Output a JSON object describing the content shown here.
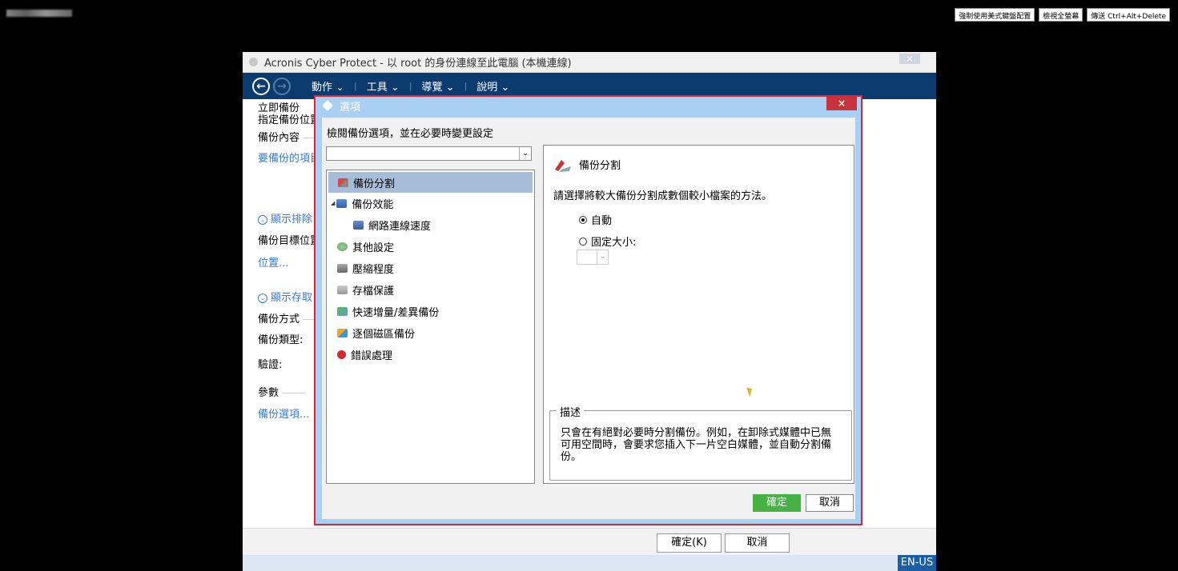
{
  "top_buttons": [
    "強制使用美式鍵盤配置",
    "檢視全螢幕",
    "傳送 Ctrl+Alt+Delete"
  ],
  "window": {
    "title": "Acronis Cyber Protect - 以 root 的身份連線至此電腦 (本機連線)",
    "close_label": "×",
    "menu": [
      "動作",
      "工具",
      "導覽",
      "說明"
    ]
  },
  "left_panel": {
    "items": [
      "立即備份",
      "指定備份位置",
      "備份內容",
      "要備份的項目",
      "顯示排除",
      "備份目標位置",
      "位置...",
      "顯示存取",
      "備份方式",
      "備份類型:",
      "驗證:",
      "參數",
      "備份選項..."
    ]
  },
  "bottom": {
    "ok": "確定(K)",
    "cancel": "取消",
    "lang": "EN-US"
  },
  "dialog": {
    "title": "選項",
    "close": "×",
    "hint": "檢閱備份選項，並在必要時變更設定",
    "tree": [
      {
        "label": "備份分割",
        "icon": "split-icon",
        "selected": true
      },
      {
        "label": "備份效能",
        "icon": "performance-icon"
      },
      {
        "label": "網路連線速度",
        "icon": "network-icon"
      },
      {
        "label": "其他設定",
        "icon": "settings-icon"
      },
      {
        "label": "壓縮程度",
        "icon": "compression-icon"
      },
      {
        "label": "存檔保護",
        "icon": "lock-icon"
      },
      {
        "label": "快速增量/差異備份",
        "icon": "incremental-icon"
      },
      {
        "label": "逐個磁區備份",
        "icon": "sector-icon"
      },
      {
        "label": "錯誤處理",
        "icon": "error-icon"
      }
    ],
    "right": {
      "heading": "備份分割",
      "description": "請選擇將較大備份分割成數個較小檔案的方法。",
      "option_auto": "自動",
      "option_fixed": "固定大小:",
      "desc_legend": "描述",
      "desc_text": "只會在有絕對必要時分割備份。例如，在卸除式媒體中已無可用空間時，會要求您插入下一片空白媒體，並自動分割備份。"
    },
    "ok": "確定",
    "cancel": "取消"
  },
  "colors": {
    "accent_navy": "#0c3b6f",
    "dialog_blue": "#a9d0f2",
    "ok_green": "#45b243",
    "highlight_red": "#e02430"
  }
}
